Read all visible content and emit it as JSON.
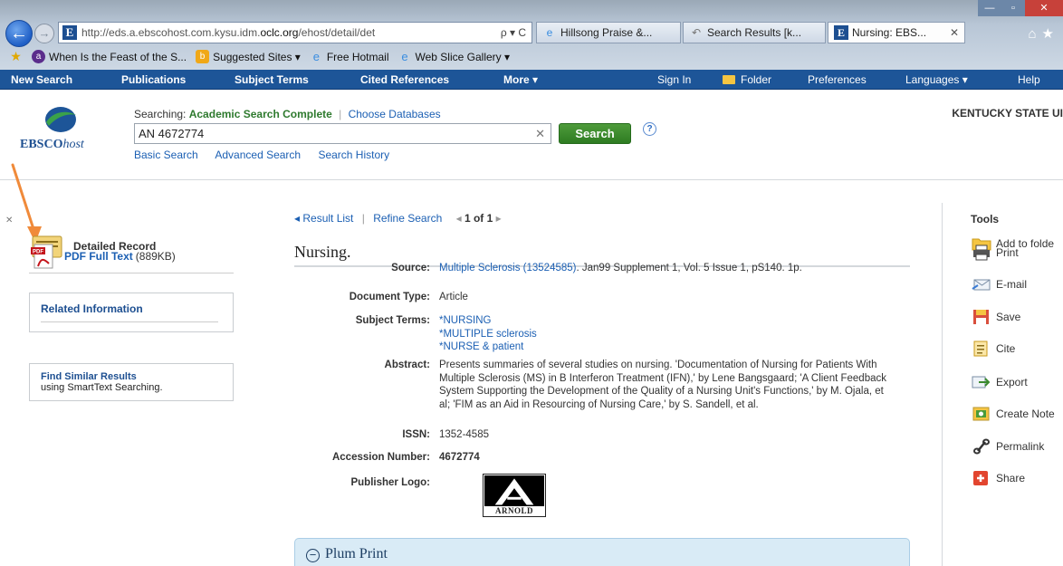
{
  "browser": {
    "url_prefix": "http://eds.a.ebscohost.com.kysu.idm.",
    "url_domain": "oclc.org",
    "url_suffix": "/ehost/detail/det",
    "addr_icons": "ρ ▾ C",
    "tabs": [
      {
        "label": "Hillsong Praise &..."
      },
      {
        "label": "Search Results [k..."
      },
      {
        "label": "Nursing: EBS..."
      }
    ],
    "favorites": [
      {
        "label": "When Is the Feast of the S..."
      },
      {
        "label": "Suggested Sites ▾"
      },
      {
        "label": "Free Hotmail"
      },
      {
        "label": "Web Slice Gallery ▾"
      }
    ]
  },
  "topnav": {
    "new_search": "New Search",
    "publications": "Publications",
    "subject_terms": "Subject Terms",
    "cited_references": "Cited References",
    "more": "More ▾",
    "sign_in": "Sign In",
    "folder": "Folder",
    "preferences": "Preferences",
    "languages": "Languages ▾",
    "help": "Help"
  },
  "search": {
    "logo_brand": "EBSCO",
    "logo_suffix": "host",
    "searching_label": "Searching:",
    "database": "Academic Search Complete",
    "choose_databases": "Choose Databases",
    "query": "AN 4672774",
    "button": "Search",
    "help": "?",
    "basic": "Basic Search",
    "advanced": "Advanced Search",
    "history": "Search History",
    "institution": "KENTUCKY STATE UI"
  },
  "left": {
    "detailed_record": "Detailed Record",
    "pdf_full_text": "PDF Full Text",
    "pdf_size": "(889KB)",
    "related_information": "Related Information",
    "find_similar": "Find Similar Results",
    "find_similar_sub": "using SmartText Searching."
  },
  "record": {
    "result_list": "◂ Result List",
    "refine_search": "Refine Search",
    "prev": "◂",
    "position": "1 of 1",
    "next": "▸",
    "title": "Nursing.",
    "fields": {
      "source_label": "Source:",
      "source_link": "Multiple Sclerosis (13524585)",
      "source_rest": ". Jan99 Supplement 1, Vol. 5 Issue 1, pS140. 1p.",
      "doctype_label": "Document Type:",
      "doctype": "Article",
      "subjects_label": "Subject Terms:",
      "subjects": [
        "*NURSING",
        "*MULTIPLE sclerosis",
        "*NURSE & patient"
      ],
      "abstract_label": "Abstract:",
      "abstract": "Presents summaries of several studies on nursing. 'Documentation of Nursing for Patients With Multiple Sclerosis (MS) in B Interferon Treatment (IFN),' by Lene Bangsgaard; 'A Client Feedback System Supporting the Development of the Quality of a Nursing Unit's Functions,' by M. Ojala, et al; 'FIM as an Aid in Resourcing of Nursing Care,' by S. Sandell, et al.",
      "issn_label": "ISSN:",
      "issn": "1352-4585",
      "accession_label": "Accession Number:",
      "accession": "4672774",
      "publisher_label": "Publisher Logo:",
      "publisher_logo_text": "ARNOLD"
    },
    "plum_print": "Plum Print",
    "plum_toggle": "−"
  },
  "tools": {
    "title": "Tools",
    "items": [
      "Add to folde",
      "Print",
      "E-mail",
      "Save",
      "Cite",
      "Export",
      "Create Note",
      "Permalink",
      "Share"
    ]
  },
  "colors": {
    "nav_blue": "#1d5598",
    "link_blue": "#1b5fb3",
    "search_green": "#2e7c22",
    "arrow_orange": "#f08a3a"
  }
}
